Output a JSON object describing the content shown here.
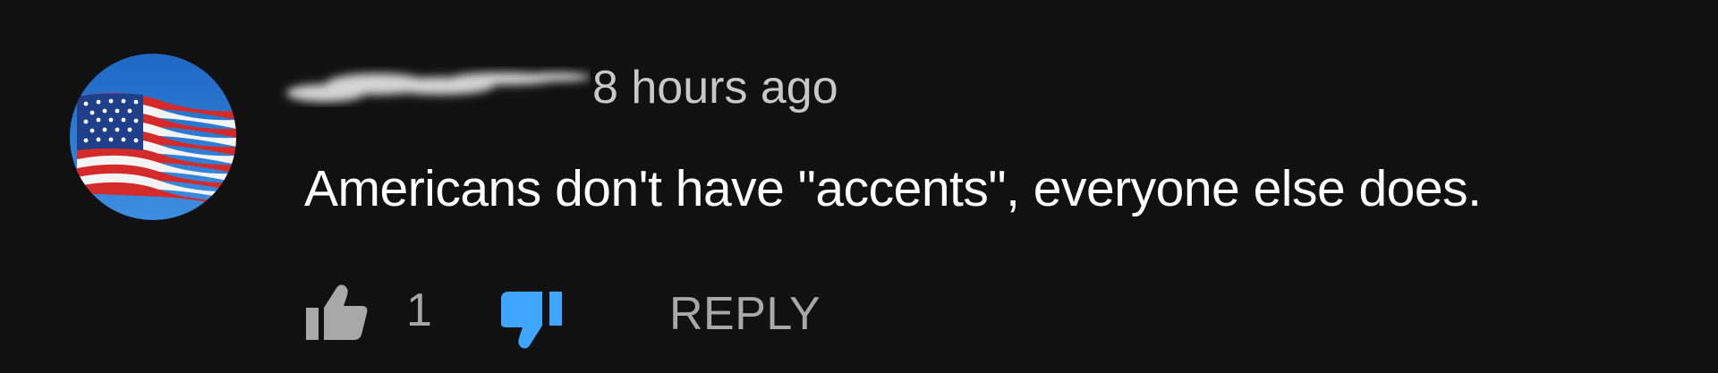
{
  "comment": {
    "avatar_icon": "american-flag-avatar",
    "author_redacted": true,
    "timestamp": "8 hours ago",
    "text": "Americans don't have \"accents\", everyone else does.",
    "likes": {
      "icon": "thumbs-up-icon",
      "count": "1"
    },
    "dislike": {
      "icon": "thumbs-down-icon",
      "active": true
    },
    "reply_label": "REPLY"
  },
  "colors": {
    "background": "#111111",
    "text_primary": "#ffffff",
    "text_secondary": "#a8a8a8",
    "dislike_active": "#3ea6ff"
  }
}
